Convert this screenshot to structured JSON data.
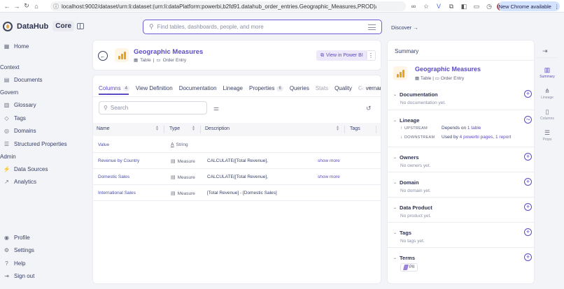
{
  "browser": {
    "url": "localhost:9002/dataset/urn:li:dataset:(urn:li:dataPlatform:powerbi,b2fd91.datahub_order_entries.Geographic_Measures,PROD)/...",
    "new_chrome": "New Chrome available"
  },
  "app": {
    "name": "DataHub",
    "badge": "Core",
    "search_placeholder": "Find tables, dashboards, people, and more",
    "discover": "Discover →"
  },
  "sidebar": {
    "home": "Home",
    "sections": {
      "context": "Context",
      "govern": "Govern",
      "admin": "Admin"
    },
    "context_items": [
      "Documents"
    ],
    "govern_items": [
      "Glossary",
      "Tags",
      "Domains",
      "Structured Properties"
    ],
    "admin_items": [
      "Data Sources",
      "Analytics"
    ],
    "bottom_items": [
      "Profile",
      "Settings",
      "Help",
      "Sign out"
    ]
  },
  "entity": {
    "title": "Geographic Measures",
    "type": "Table",
    "container": "Order Entry",
    "view_button": "View in Power BI"
  },
  "tabs": [
    {
      "label": "Columns",
      "count": "4"
    },
    {
      "label": "View Definition"
    },
    {
      "label": "Documentation"
    },
    {
      "label": "Lineage"
    },
    {
      "label": "Properties",
      "count": "6"
    },
    {
      "label": "Queries"
    },
    {
      "label": "Stats"
    },
    {
      "label": "Quality"
    },
    {
      "label": "Governance"
    }
  ],
  "table": {
    "search_placeholder": "Search",
    "headers": {
      "name": "Name",
      "type": "Type",
      "description": "Description",
      "tags": "Tags"
    },
    "rows": [
      {
        "name": "Value",
        "type": "String",
        "description": "",
        "more": ""
      },
      {
        "name": "Revenue by Country",
        "type": "Measure",
        "description": "CALCULATE([Total Revenue],",
        "more": "show more"
      },
      {
        "name": "Domestic Sales",
        "type": "Measure",
        "description": "CALCULATE([Total Revenue],",
        "more": "show more"
      },
      {
        "name": "International Sales",
        "type": "Measure",
        "description": "[Total Revenue] - [Domestic Sales]",
        "more": ""
      }
    ]
  },
  "summary": {
    "heading": "Summary",
    "title": "Geographic Measures",
    "type": "Table",
    "container": "Order Entry",
    "documentation": {
      "title": "Documentation",
      "empty": "No documentation yet."
    },
    "lineage": {
      "title": "Lineage",
      "upstream_label": "UPSTREAM",
      "upstream_prefix": "Depends on",
      "upstream_link": "1 table",
      "downstream_label": "DOWNSTREAM",
      "downstream_prefix": "Used by",
      "downstream_link": "4 powerbi pages, 1 report"
    },
    "owners": {
      "title": "Owners",
      "empty": "No owners yet."
    },
    "domain": {
      "title": "Domain",
      "empty": "No domain yet."
    },
    "data_product": {
      "title": "Data Product",
      "empty": "No product yet."
    },
    "tags": {
      "title": "Tags",
      "empty": "No tags yet."
    },
    "terms": {
      "title": "Terms",
      "chip": "PII"
    }
  },
  "rail": {
    "summary": "Summary",
    "lineage": "Lineage",
    "columns": "Columns",
    "props": "Props"
  }
}
